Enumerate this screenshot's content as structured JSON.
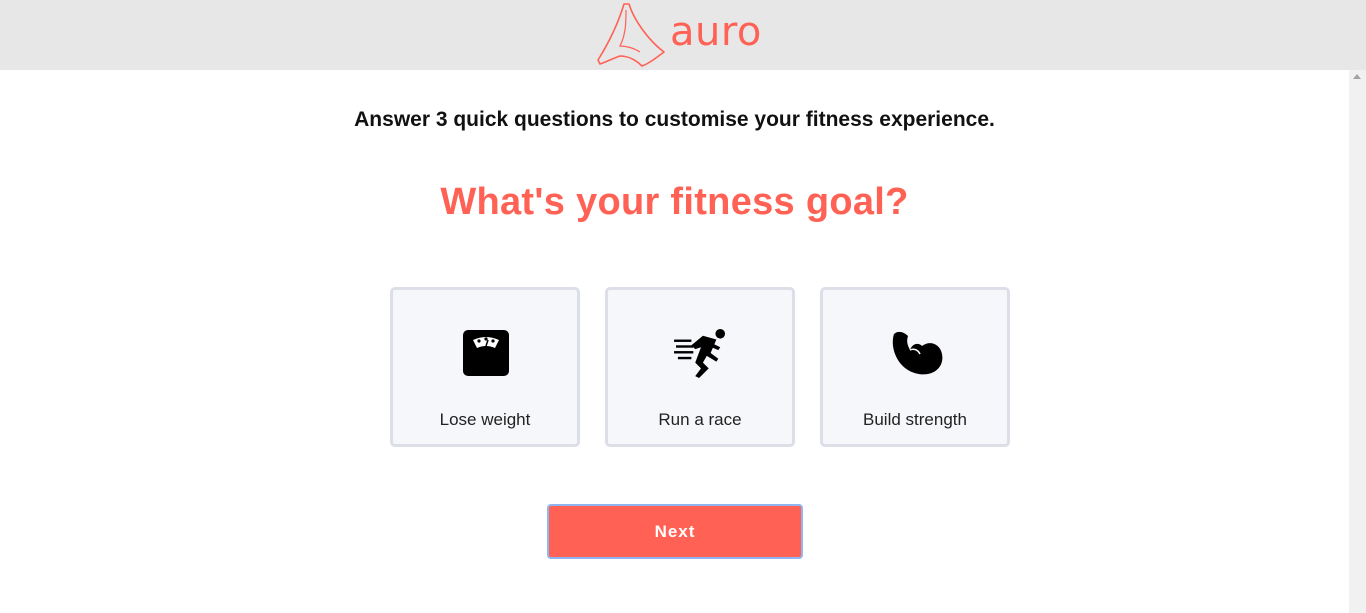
{
  "header": {
    "brand": "auro",
    "logo_icon": "auro-peak-logo-icon"
  },
  "intro": "Answer 3 quick questions to customise your fitness experience.",
  "question": "What's your fitness goal?",
  "options": [
    {
      "label": "Lose weight",
      "icon": "scale-icon"
    },
    {
      "label": "Run a race",
      "icon": "runner-icon"
    },
    {
      "label": "Build strength",
      "icon": "flexed-bicep-icon"
    }
  ],
  "next_label": "Next",
  "colors": {
    "accent": "#ff6155",
    "header_bg": "#e7e7e7",
    "card_bg": "#f6f7fb",
    "card_border": "#dcdfe8",
    "focus_ring": "#8fb6f0"
  }
}
